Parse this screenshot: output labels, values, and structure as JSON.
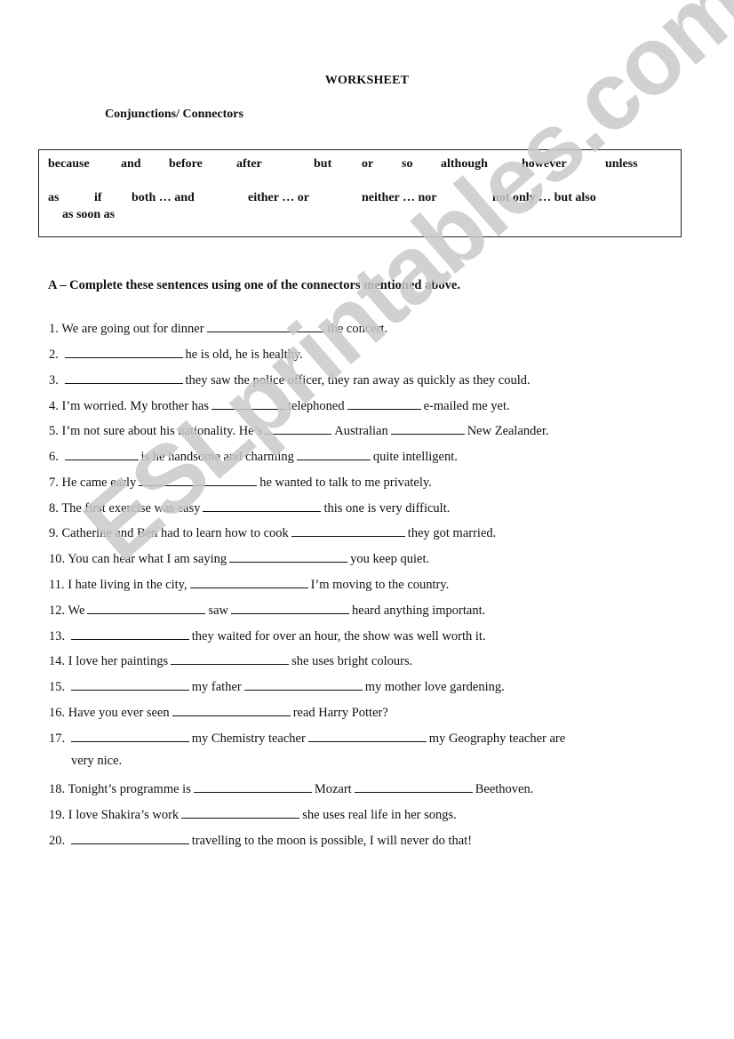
{
  "header": {
    "title": "WORKSHEET",
    "subtitle": "Conjunctions/ Connectors"
  },
  "word_bank": {
    "row1": [
      "because",
      "and",
      "before",
      "after",
      "but",
      "or",
      "so",
      "although",
      "however",
      "unless"
    ],
    "row2": [
      "as",
      "if",
      "both … and",
      "either … or",
      "neither … nor",
      "not only … but also"
    ],
    "row3": [
      "as soon as"
    ]
  },
  "section_a": {
    "instruction": "A – Complete these sentences using one of the connectors mentioned above.",
    "questions": [
      {
        "n": "1.",
        "parts": [
          "We are going out for dinner",
          "the concert."
        ]
      },
      {
        "n": "2.",
        "parts": [
          "",
          "he is old, he is healthy."
        ]
      },
      {
        "n": "3.",
        "parts": [
          "",
          "they saw the police officer, they ran away as quickly as they could."
        ]
      },
      {
        "n": "4.",
        "parts": [
          "I’m worried. My brother has",
          "telephoned",
          "e-mailed me yet."
        ]
      },
      {
        "n": "5.",
        "parts": [
          "I’m not sure about his nationality. He’s",
          "Australian",
          "New Zealander."
        ]
      },
      {
        "n": "6.",
        "parts": [
          "",
          "is he handsome and charming",
          "quite intelligent."
        ]
      },
      {
        "n": "7.",
        "parts": [
          "He came early",
          "he wanted to talk to me privately."
        ]
      },
      {
        "n": "8.",
        "parts": [
          "The first exercise was easy",
          "this one is very difficult."
        ]
      },
      {
        "n": "9.",
        "parts": [
          "Catherine and Ben had to learn how to cook",
          "they got married."
        ]
      },
      {
        "n": "10.",
        "parts": [
          "You can hear what I am saying",
          "you keep quiet."
        ]
      },
      {
        "n": "11.",
        "parts": [
          "I hate living in the city,",
          "I’m moving to the country."
        ]
      },
      {
        "n": "12.",
        "parts": [
          "We",
          "saw",
          "heard anything important."
        ]
      },
      {
        "n": "13.",
        "parts": [
          "",
          "they waited for over an hour, the show was well worth it."
        ]
      },
      {
        "n": "14.",
        "parts": [
          "I love her paintings",
          "she uses bright colours."
        ]
      },
      {
        "n": "15.",
        "parts": [
          "",
          "my father",
          "my mother love gardening."
        ]
      },
      {
        "n": "16.",
        "parts": [
          "Have you ever seen",
          "read Harry Potter?"
        ]
      },
      {
        "n": "17.",
        "parts": [
          "",
          "my Chemistry teacher",
          "my Geography teacher are"
        ],
        "continuation": "very nice."
      },
      {
        "n": "18.",
        "parts": [
          "Tonight’s programme is",
          "Mozart",
          "Beethoven."
        ]
      },
      {
        "n": "19.",
        "parts": [
          "I love Shakira’s work",
          "she uses real life in her songs."
        ]
      },
      {
        "n": "20.",
        "parts": [
          "",
          "travelling to the moon is possible, I will never do that!"
        ]
      }
    ]
  },
  "watermark": {
    "text": "ESLprintables.com",
    "color": "#c9c9c9"
  }
}
